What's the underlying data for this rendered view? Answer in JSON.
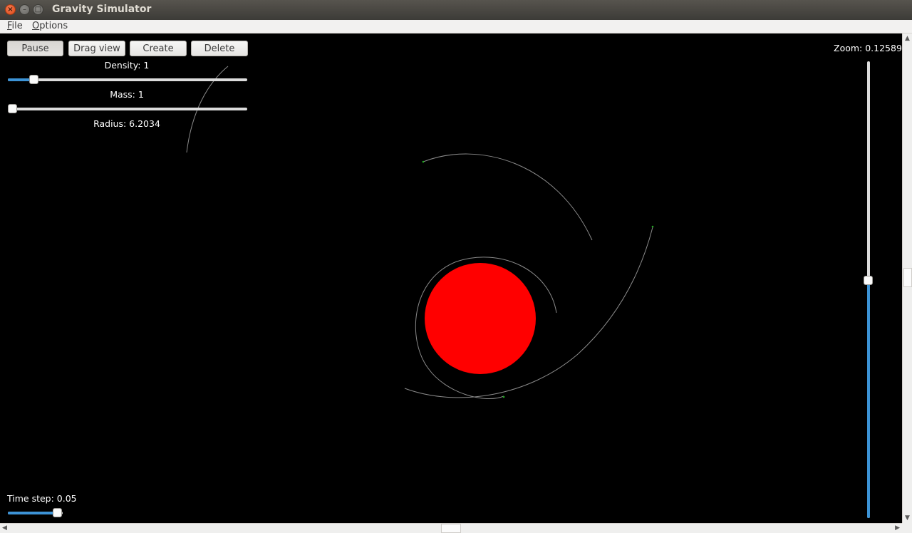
{
  "window": {
    "title": "Gravity Simulator",
    "close_glyph": "×",
    "minimize_glyph": "–",
    "maximize_glyph": "□"
  },
  "menu": {
    "file": {
      "mnemonic": "F",
      "rest": "ile"
    },
    "options": {
      "mnemonic": "O",
      "rest": "ptions"
    }
  },
  "toolbar": {
    "pause_label": "Pause",
    "drag_view_label": "Drag view",
    "create_label": "Create",
    "delete_label": "Delete"
  },
  "controls": {
    "density_label": "Density: 1",
    "density_level": 0.11,
    "mass_label": "Mass: 1",
    "mass_level": 0.0,
    "radius_label": "Radius: 6.2034",
    "time_step_label": "Time step: 0.05",
    "time_step_level": 1.0,
    "zoom_label": "Zoom: 0.125893",
    "zoom_level": 0.52
  },
  "colors": {
    "planet": "#ff0000",
    "orbit_trail": "#8a8a8a",
    "satellite": "#22aa22",
    "slider_fill": "#3c93d6"
  },
  "icons": {
    "scroll_up": "up-arrow-icon",
    "scroll_down": "down-arrow-icon",
    "scroll_left": "left-arrow-icon",
    "scroll_right": "right-arrow-icon"
  }
}
